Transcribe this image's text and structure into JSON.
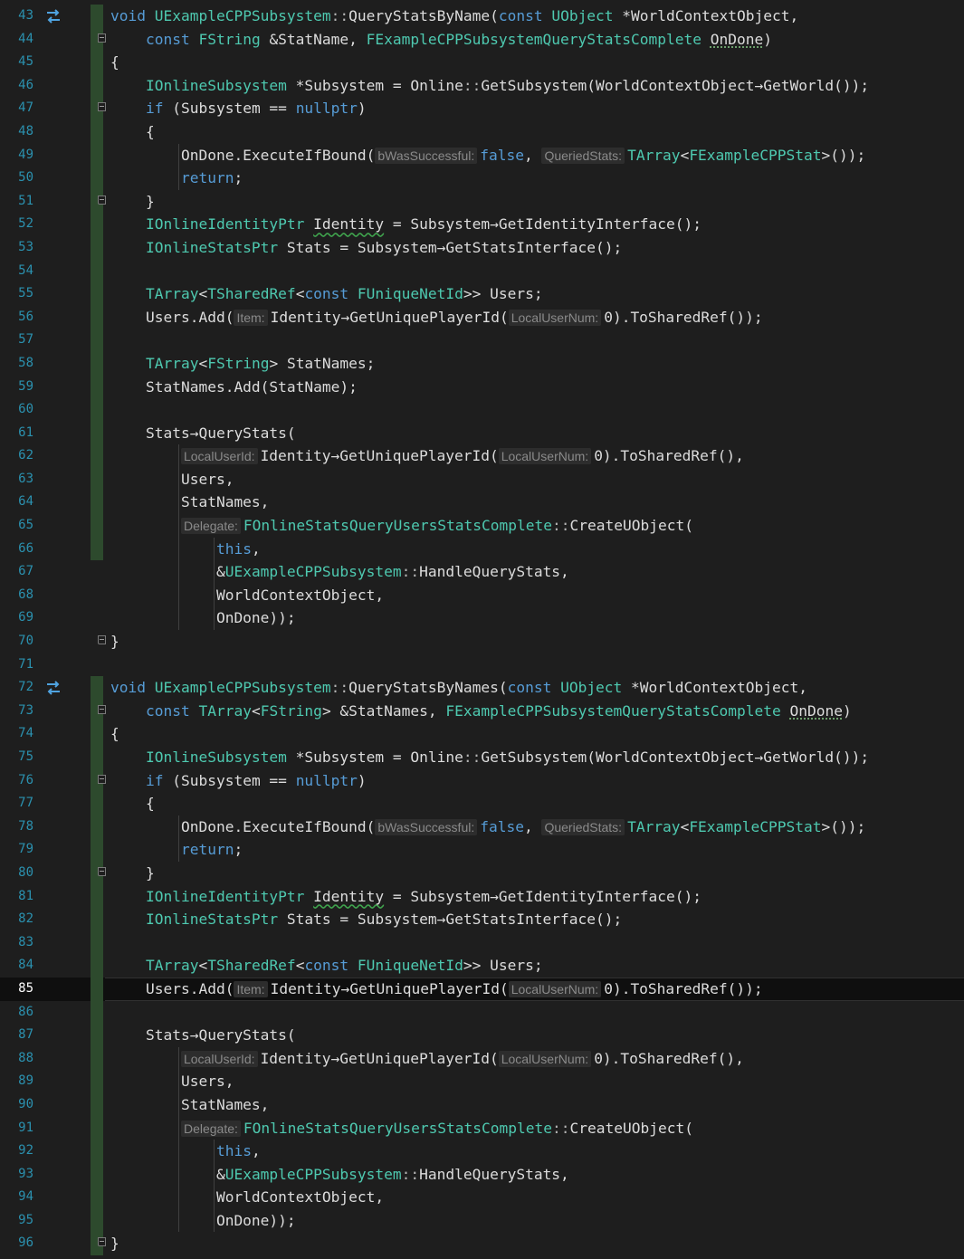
{
  "editor": {
    "colors": {
      "background": "#1e1e1e",
      "line_number": "#2b91af",
      "keyword": "#569cd6",
      "type": "#4ec9b0",
      "text": "#dcdcdc",
      "inlay_hint_bg": "#2d2d2d",
      "change_bar": "#2d4a2d"
    },
    "current_line": 85,
    "lines": [
      {
        "n": "43",
        "glyph": "swap-arrows-icon",
        "fold": "",
        "bar": "green",
        "tokens": [
          [
            "kw",
            "void "
          ],
          [
            "ty",
            "UExampleCPPSubsystem"
          ],
          [
            "op",
            "::"
          ],
          [
            "pl",
            "QueryStatsByName("
          ],
          [
            "kw",
            "const "
          ],
          [
            "ty",
            "UObject "
          ],
          [
            "pl",
            "*WorldContextObject,"
          ]
        ]
      },
      {
        "n": "44",
        "glyph": "",
        "fold": "start",
        "bar": "green",
        "tokens": [
          [
            "pl",
            "    "
          ],
          [
            "kw",
            "const "
          ],
          [
            "ty",
            "FString "
          ],
          [
            "pl",
            "&StatName, "
          ],
          [
            "ty",
            "FExampleCPPSubsystemQueryStatsComplete "
          ],
          [
            "dot",
            "OnDone"
          ],
          [
            "pl",
            ")"
          ]
        ]
      },
      {
        "n": "45",
        "glyph": "",
        "fold": "",
        "bar": "green",
        "tokens": [
          [
            "pl",
            "{"
          ]
        ]
      },
      {
        "n": "46",
        "glyph": "",
        "fold": "",
        "bar": "green",
        "tokens": [
          [
            "pl",
            "    "
          ],
          [
            "ty",
            "IOnlineSubsystem "
          ],
          [
            "pl",
            "*Subsystem = Online"
          ],
          [
            "op",
            "::"
          ],
          [
            "pl",
            "GetSubsystem(WorldContextObject→GetWorld());"
          ]
        ]
      },
      {
        "n": "47",
        "glyph": "",
        "fold": "start",
        "bar": "green",
        "tokens": [
          [
            "pl",
            "    "
          ],
          [
            "kw",
            "if "
          ],
          [
            "pl",
            "(Subsystem == "
          ],
          [
            "kw",
            "nullptr"
          ],
          [
            "pl",
            ")"
          ]
        ]
      },
      {
        "n": "48",
        "glyph": "",
        "fold": "",
        "bar": "green",
        "tokens": [
          [
            "pl",
            "    {"
          ]
        ]
      },
      {
        "n": "49",
        "glyph": "",
        "fold": "",
        "bar": "green",
        "tokens": [
          [
            "pl",
            "        OnDone.ExecuteIfBound("
          ],
          [
            "hint",
            "bWasSuccessful:"
          ],
          [
            "kw",
            "false"
          ],
          [
            "pl",
            ", "
          ],
          [
            "hint",
            "QueriedStats:"
          ],
          [
            "ty",
            "TArray"
          ],
          [
            "pl",
            "<"
          ],
          [
            "ty",
            "FExampleCPPStat"
          ],
          [
            "pl",
            ">());"
          ]
        ]
      },
      {
        "n": "50",
        "glyph": "",
        "fold": "",
        "bar": "green",
        "tokens": [
          [
            "pl",
            "        "
          ],
          [
            "kw",
            "return"
          ],
          [
            "pl",
            ";"
          ]
        ]
      },
      {
        "n": "51",
        "glyph": "",
        "fold": "end",
        "bar": "green",
        "tokens": [
          [
            "pl",
            "    }"
          ]
        ]
      },
      {
        "n": "52",
        "glyph": "",
        "fold": "",
        "bar": "green",
        "tokens": [
          [
            "pl",
            "    "
          ],
          [
            "ty",
            "IOnlineIdentityPtr "
          ],
          [
            "sq",
            "Identity"
          ],
          [
            "pl",
            " = Subsystem→GetIdentityInterface();"
          ]
        ]
      },
      {
        "n": "53",
        "glyph": "",
        "fold": "",
        "bar": "green",
        "tokens": [
          [
            "pl",
            "    "
          ],
          [
            "ty",
            "IOnlineStatsPtr "
          ],
          [
            "pl",
            "Stats = Subsystem→GetStatsInterface();"
          ]
        ]
      },
      {
        "n": "54",
        "glyph": "",
        "fold": "",
        "bar": "green",
        "tokens": []
      },
      {
        "n": "55",
        "glyph": "",
        "fold": "",
        "bar": "green",
        "tokens": [
          [
            "pl",
            "    "
          ],
          [
            "ty",
            "TArray"
          ],
          [
            "pl",
            "<"
          ],
          [
            "ty",
            "TSharedRef"
          ],
          [
            "pl",
            "<"
          ],
          [
            "kw",
            "const "
          ],
          [
            "ty",
            "FUniqueNetId"
          ],
          [
            "pl",
            ">> Users;"
          ]
        ]
      },
      {
        "n": "56",
        "glyph": "",
        "fold": "",
        "bar": "green",
        "tokens": [
          [
            "pl",
            "    Users.Add("
          ],
          [
            "hint",
            "Item:"
          ],
          [
            "pl",
            "Identity→GetUniquePlayerId("
          ],
          [
            "hint",
            "LocalUserNum:"
          ],
          [
            "pl",
            "0).ToSharedRef());"
          ]
        ]
      },
      {
        "n": "57",
        "glyph": "",
        "fold": "",
        "bar": "green",
        "tokens": []
      },
      {
        "n": "58",
        "glyph": "",
        "fold": "",
        "bar": "green",
        "tokens": [
          [
            "pl",
            "    "
          ],
          [
            "ty",
            "TArray"
          ],
          [
            "pl",
            "<"
          ],
          [
            "ty",
            "FString"
          ],
          [
            "pl",
            "> StatNames;"
          ]
        ]
      },
      {
        "n": "59",
        "glyph": "",
        "fold": "",
        "bar": "green",
        "tokens": [
          [
            "pl",
            "    StatNames.Add(StatName);"
          ]
        ]
      },
      {
        "n": "60",
        "glyph": "",
        "fold": "",
        "bar": "green",
        "tokens": []
      },
      {
        "n": "61",
        "glyph": "",
        "fold": "",
        "bar": "green",
        "tokens": [
          [
            "pl",
            "    Stats→QueryStats("
          ]
        ]
      },
      {
        "n": "62",
        "glyph": "",
        "fold": "",
        "bar": "green",
        "tokens": [
          [
            "pl",
            "        "
          ],
          [
            "hint",
            "LocalUserId:"
          ],
          [
            "pl",
            "Identity→GetUniquePlayerId("
          ],
          [
            "hint",
            "LocalUserNum:"
          ],
          [
            "pl",
            "0).ToSharedRef(),"
          ]
        ]
      },
      {
        "n": "63",
        "glyph": "",
        "fold": "",
        "bar": "green",
        "tokens": [
          [
            "pl",
            "        Users,"
          ]
        ]
      },
      {
        "n": "64",
        "glyph": "",
        "fold": "",
        "bar": "green",
        "tokens": [
          [
            "pl",
            "        StatNames,"
          ]
        ]
      },
      {
        "n": "65",
        "glyph": "",
        "fold": "",
        "bar": "green",
        "tokens": [
          [
            "pl",
            "        "
          ],
          [
            "hint",
            "Delegate:"
          ],
          [
            "ty",
            "FOnlineStatsQueryUsersStatsComplete"
          ],
          [
            "op",
            "::"
          ],
          [
            "pl",
            "CreateUObject("
          ]
        ]
      },
      {
        "n": "66",
        "glyph": "",
        "fold": "",
        "bar": "green",
        "tokens": [
          [
            "pl",
            "            "
          ],
          [
            "kw",
            "this"
          ],
          [
            "pl",
            ","
          ]
        ]
      },
      {
        "n": "67",
        "glyph": "",
        "fold": "",
        "bar": "none",
        "tokens": [
          [
            "pl",
            "            &"
          ],
          [
            "ty",
            "UExampleCPPSubsystem"
          ],
          [
            "op",
            "::"
          ],
          [
            "pl",
            "HandleQueryStats,"
          ]
        ]
      },
      {
        "n": "68",
        "glyph": "",
        "fold": "",
        "bar": "none",
        "tokens": [
          [
            "pl",
            "            WorldContextObject,"
          ]
        ]
      },
      {
        "n": "69",
        "glyph": "",
        "fold": "",
        "bar": "none",
        "tokens": [
          [
            "pl",
            "            OnDone));"
          ]
        ]
      },
      {
        "n": "70",
        "glyph": "",
        "fold": "end",
        "bar": "none",
        "tokens": [
          [
            "pl",
            "}"
          ]
        ]
      },
      {
        "n": "71",
        "glyph": "",
        "fold": "",
        "bar": "none",
        "tokens": []
      },
      {
        "n": "72",
        "glyph": "swap-arrows-icon",
        "fold": "",
        "bar": "green",
        "tokens": [
          [
            "kw",
            "void "
          ],
          [
            "ty",
            "UExampleCPPSubsystem"
          ],
          [
            "op",
            "::"
          ],
          [
            "pl",
            "QueryStatsByNames("
          ],
          [
            "kw",
            "const "
          ],
          [
            "ty",
            "UObject "
          ],
          [
            "pl",
            "*WorldContextObject,"
          ]
        ]
      },
      {
        "n": "73",
        "glyph": "",
        "fold": "start",
        "bar": "green",
        "tokens": [
          [
            "pl",
            "    "
          ],
          [
            "kw",
            "const "
          ],
          [
            "ty",
            "TArray"
          ],
          [
            "pl",
            "<"
          ],
          [
            "ty",
            "FString"
          ],
          [
            "pl",
            "> &StatNames, "
          ],
          [
            "ty",
            "FExampleCPPSubsystemQueryStatsComplete "
          ],
          [
            "dot",
            "OnDone"
          ],
          [
            "pl",
            ")"
          ]
        ]
      },
      {
        "n": "74",
        "glyph": "",
        "fold": "",
        "bar": "green",
        "tokens": [
          [
            "pl",
            "{"
          ]
        ]
      },
      {
        "n": "75",
        "glyph": "",
        "fold": "",
        "bar": "green",
        "tokens": [
          [
            "pl",
            "    "
          ],
          [
            "ty",
            "IOnlineSubsystem "
          ],
          [
            "pl",
            "*Subsystem = Online"
          ],
          [
            "op",
            "::"
          ],
          [
            "pl",
            "GetSubsystem(WorldContextObject→GetWorld());"
          ]
        ]
      },
      {
        "n": "76",
        "glyph": "",
        "fold": "start",
        "bar": "green",
        "tokens": [
          [
            "pl",
            "    "
          ],
          [
            "kw",
            "if "
          ],
          [
            "pl",
            "(Subsystem == "
          ],
          [
            "kw",
            "nullptr"
          ],
          [
            "pl",
            ")"
          ]
        ]
      },
      {
        "n": "77",
        "glyph": "",
        "fold": "",
        "bar": "green",
        "tokens": [
          [
            "pl",
            "    {"
          ]
        ]
      },
      {
        "n": "78",
        "glyph": "",
        "fold": "",
        "bar": "green",
        "tokens": [
          [
            "pl",
            "        OnDone.ExecuteIfBound("
          ],
          [
            "hint",
            "bWasSuccessful:"
          ],
          [
            "kw",
            "false"
          ],
          [
            "pl",
            ", "
          ],
          [
            "hint",
            "QueriedStats:"
          ],
          [
            "ty",
            "TArray"
          ],
          [
            "pl",
            "<"
          ],
          [
            "ty",
            "FExampleCPPStat"
          ],
          [
            "pl",
            ">());"
          ]
        ]
      },
      {
        "n": "79",
        "glyph": "",
        "fold": "",
        "bar": "green",
        "tokens": [
          [
            "pl",
            "        "
          ],
          [
            "kw",
            "return"
          ],
          [
            "pl",
            ";"
          ]
        ]
      },
      {
        "n": "80",
        "glyph": "",
        "fold": "end",
        "bar": "green",
        "tokens": [
          [
            "pl",
            "    }"
          ]
        ]
      },
      {
        "n": "81",
        "glyph": "",
        "fold": "",
        "bar": "green",
        "tokens": [
          [
            "pl",
            "    "
          ],
          [
            "ty",
            "IOnlineIdentityPtr "
          ],
          [
            "sq",
            "Identity"
          ],
          [
            "pl",
            " = Subsystem→GetIdentityInterface();"
          ]
        ]
      },
      {
        "n": "82",
        "glyph": "",
        "fold": "",
        "bar": "green",
        "tokens": [
          [
            "pl",
            "    "
          ],
          [
            "ty",
            "IOnlineStatsPtr "
          ],
          [
            "pl",
            "Stats = Subsystem→GetStatsInterface();"
          ]
        ]
      },
      {
        "n": "83",
        "glyph": "",
        "fold": "",
        "bar": "green",
        "tokens": []
      },
      {
        "n": "84",
        "glyph": "",
        "fold": "",
        "bar": "green",
        "tokens": [
          [
            "pl",
            "    "
          ],
          [
            "ty",
            "TArray"
          ],
          [
            "pl",
            "<"
          ],
          [
            "ty",
            "TSharedRef"
          ],
          [
            "pl",
            "<"
          ],
          [
            "kw",
            "const "
          ],
          [
            "ty",
            "FUniqueNetId"
          ],
          [
            "pl",
            ">> Users;"
          ]
        ]
      },
      {
        "n": "85",
        "glyph": "",
        "fold": "",
        "bar": "green",
        "tokens": [
          [
            "pl",
            "    Users.Add("
          ],
          [
            "hint",
            "Item:"
          ],
          [
            "pl",
            "Identity→GetUniquePlayerId("
          ],
          [
            "hint",
            "LocalUserNum:"
          ],
          [
            "pl",
            "0).ToSharedRef());"
          ]
        ]
      },
      {
        "n": "86",
        "glyph": "",
        "fold": "",
        "bar": "green",
        "tokens": []
      },
      {
        "n": "87",
        "glyph": "",
        "fold": "",
        "bar": "green",
        "tokens": [
          [
            "pl",
            "    Stats→QueryStats("
          ]
        ]
      },
      {
        "n": "88",
        "glyph": "",
        "fold": "",
        "bar": "green",
        "tokens": [
          [
            "pl",
            "        "
          ],
          [
            "hint",
            "LocalUserId:"
          ],
          [
            "pl",
            "Identity→GetUniquePlayerId("
          ],
          [
            "hint",
            "LocalUserNum:"
          ],
          [
            "pl",
            "0).ToSharedRef(),"
          ]
        ]
      },
      {
        "n": "89",
        "glyph": "",
        "fold": "",
        "bar": "green",
        "tokens": [
          [
            "pl",
            "        Users,"
          ]
        ]
      },
      {
        "n": "90",
        "glyph": "",
        "fold": "",
        "bar": "green",
        "tokens": [
          [
            "pl",
            "        StatNames,"
          ]
        ]
      },
      {
        "n": "91",
        "glyph": "",
        "fold": "",
        "bar": "green",
        "tokens": [
          [
            "pl",
            "        "
          ],
          [
            "hint",
            "Delegate:"
          ],
          [
            "ty",
            "FOnlineStatsQueryUsersStatsComplete"
          ],
          [
            "op",
            "::"
          ],
          [
            "pl",
            "CreateUObject("
          ]
        ]
      },
      {
        "n": "92",
        "glyph": "",
        "fold": "",
        "bar": "green",
        "tokens": [
          [
            "pl",
            "            "
          ],
          [
            "kw",
            "this"
          ],
          [
            "pl",
            ","
          ]
        ]
      },
      {
        "n": "93",
        "glyph": "",
        "fold": "",
        "bar": "green",
        "tokens": [
          [
            "pl",
            "            &"
          ],
          [
            "ty",
            "UExampleCPPSubsystem"
          ],
          [
            "op",
            "::"
          ],
          [
            "pl",
            "HandleQueryStats,"
          ]
        ]
      },
      {
        "n": "94",
        "glyph": "",
        "fold": "",
        "bar": "green",
        "tokens": [
          [
            "pl",
            "            WorldContextObject,"
          ]
        ]
      },
      {
        "n": "95",
        "glyph": "",
        "fold": "",
        "bar": "green",
        "tokens": [
          [
            "pl",
            "            OnDone));"
          ]
        ]
      },
      {
        "n": "96",
        "glyph": "",
        "fold": "end",
        "bar": "green",
        "tokens": [
          [
            "pl",
            "}"
          ]
        ]
      }
    ]
  }
}
